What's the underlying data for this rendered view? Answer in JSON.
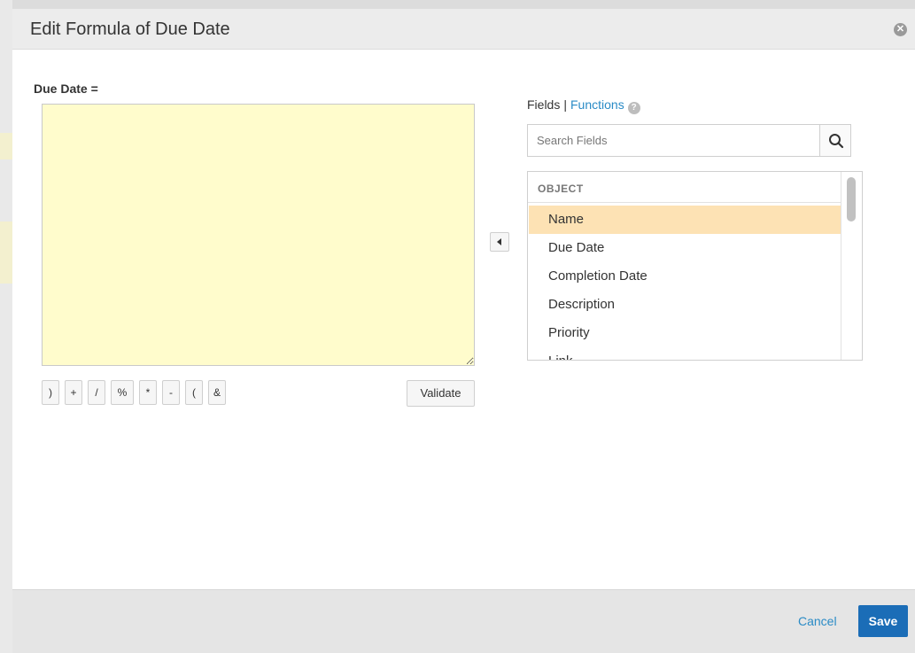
{
  "dialog": {
    "title": "Edit Formula of Due Date"
  },
  "formula": {
    "label": "Due Date =",
    "value": ""
  },
  "operators": [
    ")",
    "+",
    "/",
    "%",
    "*",
    "-",
    "(",
    "&"
  ],
  "validate_label": "Validate",
  "fields_panel": {
    "fields_label": "Fields",
    "separator": "|",
    "functions_label": "Functions",
    "help_icon_glyph": "?",
    "search_placeholder": "Search Fields",
    "group_label": "OBJECT",
    "items": [
      "Name",
      "Due Date",
      "Completion Date",
      "Description",
      "Priority",
      "Link"
    ]
  },
  "footer": {
    "cancel_label": "Cancel",
    "save_label": "Save"
  },
  "colors": {
    "accent": "#1b6db7",
    "link": "#2a8bc6",
    "formula_bg": "#fffccc",
    "selected_item_bg": "#fde2b4"
  },
  "icons": {
    "close": "close-icon",
    "search": "search-icon",
    "insert": "insert-arrow-icon",
    "help": "help-icon"
  }
}
